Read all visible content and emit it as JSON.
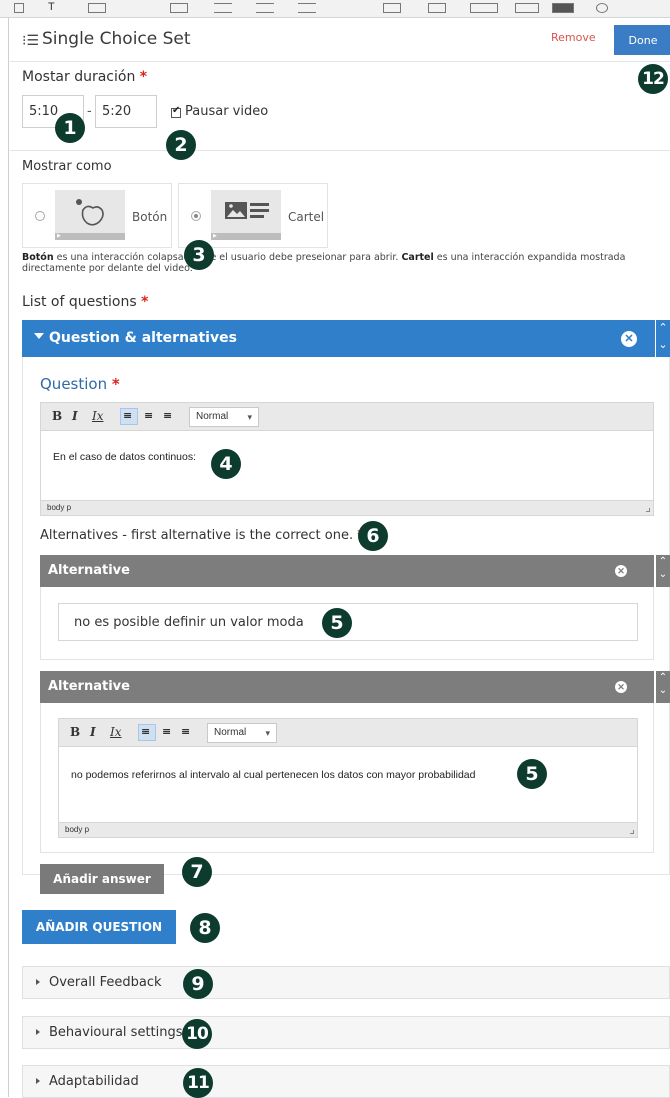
{
  "header": {
    "title": "Single Choice Set",
    "remove_label": "Remove",
    "done_label": "Done"
  },
  "duration": {
    "label": "Mostar duración",
    "required": "*",
    "start": "5:10",
    "separator": "-",
    "end": "5:20",
    "pause_label": "Pausar video"
  },
  "display_as": {
    "label": "Mostrar como",
    "options": [
      {
        "label": "Botón",
        "selected": false
      },
      {
        "label": "Cartel",
        "selected": true
      }
    ],
    "help_bold_1": "Botón",
    "help_part_1": " es una interacción colapsada que el usuario debe preseionar para abrir. ",
    "help_bold_2": "Cartel",
    "help_part_2": " es una interacción expandida mostrada directamente por delante del video."
  },
  "questions": {
    "label": "List of questions",
    "required": "*",
    "item_title": "Question & alternatives",
    "question_label": "Question",
    "editor": {
      "bold": "B",
      "italic": "I",
      "clear": "Ix",
      "format": "Normal",
      "content": "En el caso de datos continuos:",
      "path": "body  p"
    },
    "alternatives_label": "Alternatives - first alternative is the correct one.",
    "alternatives": [
      {
        "title": "Alternative",
        "text": "no es posible definir un valor moda"
      },
      {
        "title": "Alternative",
        "text": "no podemos referirnos al intervalo al cual pertenecen los datos con mayor probabilidad",
        "format": "Normal",
        "path": "body  p"
      }
    ],
    "add_answer": "Añadir answer",
    "add_question": "AÑADIR QUESTION"
  },
  "sections": [
    {
      "label": "Overall Feedback"
    },
    {
      "label": "Behavioural settings"
    },
    {
      "label": "Adaptabilidad"
    }
  ],
  "badges": {
    "b1": "1",
    "b2": "2",
    "b3": "3",
    "b4": "4",
    "b5a": "5",
    "b5b": "5",
    "b6": "6",
    "b7": "7",
    "b8": "8",
    "b9": "9",
    "b10": "10",
    "b11": "11",
    "b12": "12"
  }
}
